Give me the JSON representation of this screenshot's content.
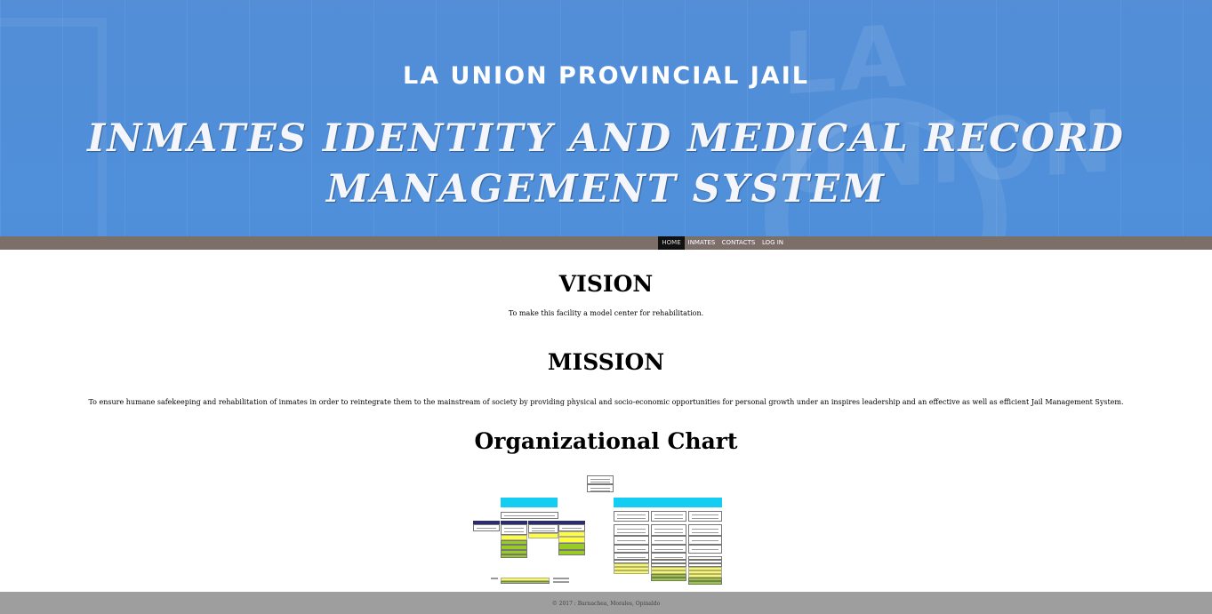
{
  "banner": {
    "title": "LA UNION PROVINCIAL JAIL",
    "subtitle_line1": "INMATES IDENTITY AND MEDICAL RECORD",
    "subtitle_line2": "MANAGEMENT SYSTEM",
    "background_color": "#4f8fda"
  },
  "nav": {
    "background_color": "#7c6e69",
    "active_color": "#111111",
    "items": [
      {
        "label": "HOME",
        "active": true
      },
      {
        "label": "INMATES",
        "active": false
      },
      {
        "label": "CONTACTS",
        "active": false
      },
      {
        "label": "LOG IN",
        "active": false
      }
    ]
  },
  "vision": {
    "heading": "VISION",
    "text": "To make this facility a model center for rehabilitation."
  },
  "mission": {
    "heading": "MISSION",
    "text": "To ensure humane safekeeping and rehabilitation of inmates in order to reintegrate them to the mainstream of society by providing physical and socio-economic opportunities for personal growth under an inspires leadership and an effective as well as efficient Jail Management System."
  },
  "org_chart": {
    "heading": "Organizational Chart",
    "image_icon": "org-chart-image",
    "colors": {
      "division": "#14cdf2",
      "unit": "#ffff33",
      "section": "#99cc22",
      "header": "#2b2b6e"
    }
  },
  "footer": {
    "text": "© 2017 : Barnachea, Morales, Opinaldo",
    "background_color": "#9e9e9e"
  }
}
